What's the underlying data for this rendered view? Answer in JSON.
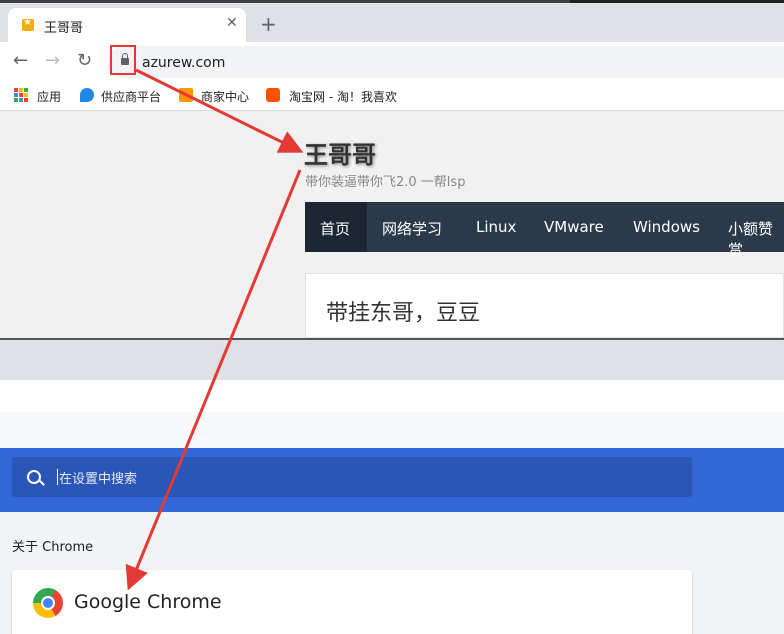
{
  "browser": {
    "tab_title": "王哥哥",
    "tab_close": "✕",
    "new_tab": "+",
    "back": "←",
    "forward": "→",
    "reload": "↻",
    "url": "azurew.com",
    "bookmarks": [
      {
        "label": "应用",
        "icon": "apps-grid-icon"
      },
      {
        "label": "供应商平台",
        "icon": "supplier-icon"
      },
      {
        "label": "商家中心",
        "icon": "merchant-icon"
      },
      {
        "label": "淘宝网 - 淘！我喜欢",
        "icon": "taobao-icon"
      }
    ]
  },
  "site": {
    "title": "王哥哥",
    "subtitle": "带你装逼带你飞2.0 一帮lsp",
    "nav": [
      "首页",
      "网络学习",
      "Linux",
      "VMware",
      "Windows",
      "小额赞赏"
    ],
    "post_title": "带挂东哥，豆豆"
  },
  "settings": {
    "search_placeholder": "在设置中搜索",
    "about_label": "关于 Chrome",
    "product_name": "Google Chrome"
  },
  "colors": {
    "annotation_red": "#e53935",
    "settings_blue": "#3367d6",
    "site_nav_bg": "#2b3a4a"
  }
}
